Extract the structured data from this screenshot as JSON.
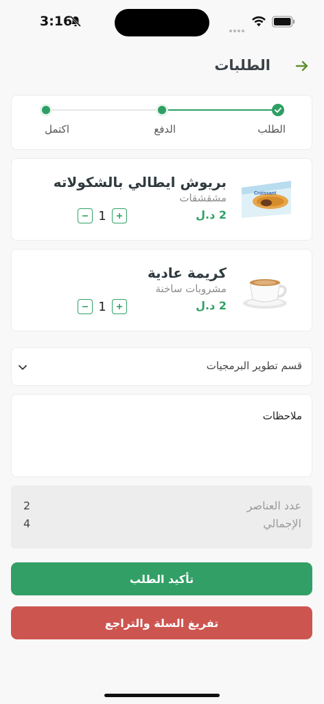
{
  "status_bar": {
    "time": "3:16"
  },
  "header": {
    "title": "الطلبات"
  },
  "stepper": {
    "steps": [
      {
        "label": "الطلب"
      },
      {
        "label": "الدفع"
      },
      {
        "label": "اكتمل"
      }
    ]
  },
  "cart": {
    "items": [
      {
        "name": "بريوش ايطالي بالشكولاته",
        "category": "مشقشقات",
        "price": "2 د.ل",
        "quantity": "1",
        "image": "croissant-package"
      },
      {
        "name": "كريمة عادية",
        "category": "مشروبات ساخنة",
        "price": "2 د.ل",
        "quantity": "1",
        "image": "coffee-cup"
      }
    ]
  },
  "department": {
    "selected": "قسم تطوير البرمجيات"
  },
  "notes": {
    "placeholder": "ملاحظات"
  },
  "summary": {
    "items_label": "عدد العناصر",
    "items_value": "2",
    "total_label": "الإجمالي",
    "total_value": "4"
  },
  "actions": {
    "confirm_label": "تأكيد الطلب",
    "clear_label": "تفريغ السلة والتراجع"
  },
  "colors": {
    "accent": "#2e9f64",
    "danger": "#cd5550",
    "summary_bg": "#ededed"
  }
}
